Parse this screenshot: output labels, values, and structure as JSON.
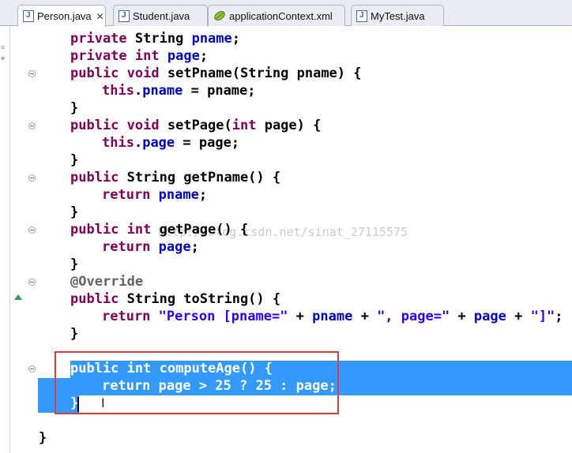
{
  "tabs": [
    {
      "label": "Person.java",
      "icon": "java-file-icon",
      "active": true,
      "close": "✕"
    },
    {
      "label": "Student.java",
      "icon": "java-file-icon",
      "active": false
    },
    {
      "label": "applicationContext.xml",
      "icon": "spring-leaf-icon",
      "active": false
    },
    {
      "label": "MyTest.java",
      "icon": "java-file-icon",
      "active": false
    }
  ],
  "code": {
    "l1": [
      "private",
      " ",
      "String",
      " ",
      "pname",
      ";"
    ],
    "l2": [
      "private",
      " ",
      "int",
      " ",
      "page",
      ";"
    ],
    "l3": [
      "public",
      " ",
      "void",
      " setPname(String pname) {"
    ],
    "l4": [
      "this",
      ".",
      "pname",
      " = pname;"
    ],
    "l5": "}",
    "l6": [
      "public",
      " ",
      "void",
      " setPage(",
      "int",
      " page) {"
    ],
    "l7": [
      "this",
      ".",
      "page",
      " = page;"
    ],
    "l8": "}",
    "l9": [
      "public",
      " String getPname() {"
    ],
    "l10": [
      "return",
      " ",
      "pname",
      ";"
    ],
    "l11": "}",
    "l12": [
      "public",
      " ",
      "int",
      " getPage() {"
    ],
    "l13": [
      "return",
      " ",
      "page",
      ";"
    ],
    "l14": "}",
    "l15": "@Override",
    "l16": [
      "public",
      " String toString() {"
    ],
    "l17": [
      "return",
      " ",
      "\"Person [pname=\"",
      " + ",
      "pname",
      " + ",
      "\", page=\"",
      " + ",
      "page",
      " + ",
      "\"]\"",
      ";"
    ],
    "l18": "}",
    "l19": [
      "public",
      " ",
      "int",
      " computeAge() {"
    ],
    "l20": [
      "return",
      " page > 25 ? 25 : page;"
    ],
    "l21": "}",
    "l22": "}"
  },
  "watermark": "http://blog.csdn.net/sinat_27115575",
  "colors": {
    "keyword": "#7f0055",
    "field": "#0000c0",
    "string": "#2a00ff",
    "annotation": "#646464",
    "selection": "#3399ff",
    "highlight_box": "#e03c3c"
  }
}
